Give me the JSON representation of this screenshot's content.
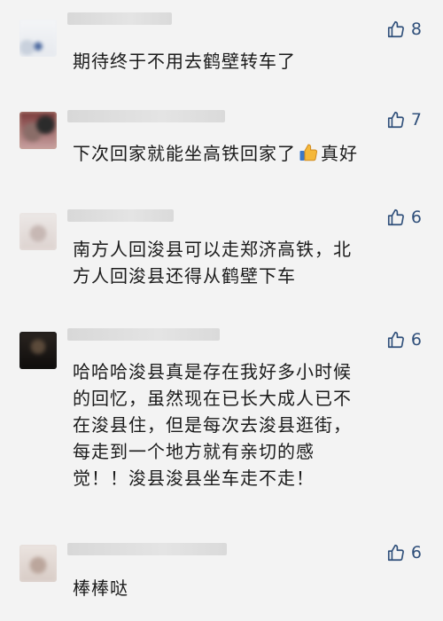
{
  "comments": [
    {
      "text": "期待终于不用去鹤壁转车了",
      "likes": "8"
    },
    {
      "text_before": "下次回家就能坐高铁回家了",
      "emoji": "thumbs-up",
      "text_after": "真好",
      "likes": "7"
    },
    {
      "lines": [
        "南方人回浚县可以走郑济高铁，北",
        "方人回浚县还得从鹤壁下车"
      ],
      "likes": "6"
    },
    {
      "lines": [
        "哈哈哈浚县真是存在我好多小时候",
        "的回忆，虽然现在已长大成人已不",
        "在浚县住，但是每次去浚县逛街，",
        "每走到一个地方就有亲切的感",
        "觉！！浚县浚县坐车走不走！"
      ],
      "likes": "6"
    },
    {
      "text": "棒棒哒",
      "likes": "6"
    }
  ],
  "colors": {
    "like": "#2f4f7a",
    "background": "#f3f3f3"
  },
  "icons": {
    "like": "thumbs-up-outline-icon"
  }
}
